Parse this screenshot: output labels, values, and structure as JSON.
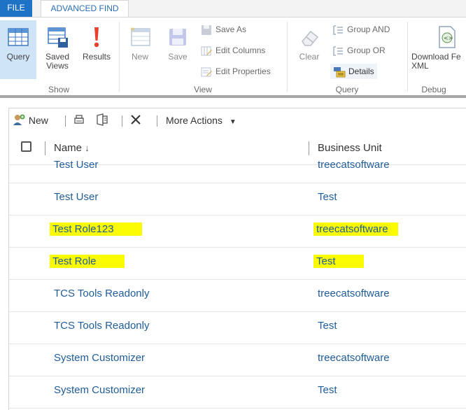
{
  "tabs": {
    "file": "FILE",
    "advanced_find": "ADVANCED FIND"
  },
  "ribbon": {
    "show": {
      "label": "Show",
      "query": "Query",
      "saved_views": "Saved Views",
      "results": "Results"
    },
    "view": {
      "label": "View",
      "new": "New",
      "save": "Save",
      "save_as": "Save As",
      "edit_columns": "Edit Columns",
      "edit_properties": "Edit Properties"
    },
    "query": {
      "label": "Query",
      "clear": "Clear",
      "group_and": "Group AND",
      "group_or": "Group OR",
      "details": "Details"
    },
    "debug": {
      "label": "Debug",
      "download": "Download Fe XML"
    }
  },
  "grid": {
    "commands": {
      "new": "New",
      "more_actions": "More Actions"
    },
    "columns": {
      "name": "Name",
      "business_unit": "Business Unit"
    },
    "rows": [
      {
        "name": "Test User",
        "business_unit": "treecatsoftware",
        "highlighted": false
      },
      {
        "name": "Test User",
        "business_unit": "Test",
        "highlighted": false
      },
      {
        "name": "Test Role123",
        "business_unit": "treecatsoftware",
        "highlighted": true
      },
      {
        "name": "Test Role",
        "business_unit": "Test",
        "highlighted": true
      },
      {
        "name": "TCS Tools Readonly",
        "business_unit": "treecatsoftware",
        "highlighted": false
      },
      {
        "name": "TCS Tools Readonly",
        "business_unit": "Test",
        "highlighted": false
      },
      {
        "name": "System Customizer",
        "business_unit": "treecatsoftware",
        "highlighted": false
      },
      {
        "name": "System Customizer",
        "business_unit": "Test",
        "highlighted": false
      }
    ]
  },
  "colors": {
    "file_tab": "#1e73c6",
    "link": "#1f5c99",
    "highlight": "#fafa00",
    "selected_button": "#cfe4f7"
  }
}
